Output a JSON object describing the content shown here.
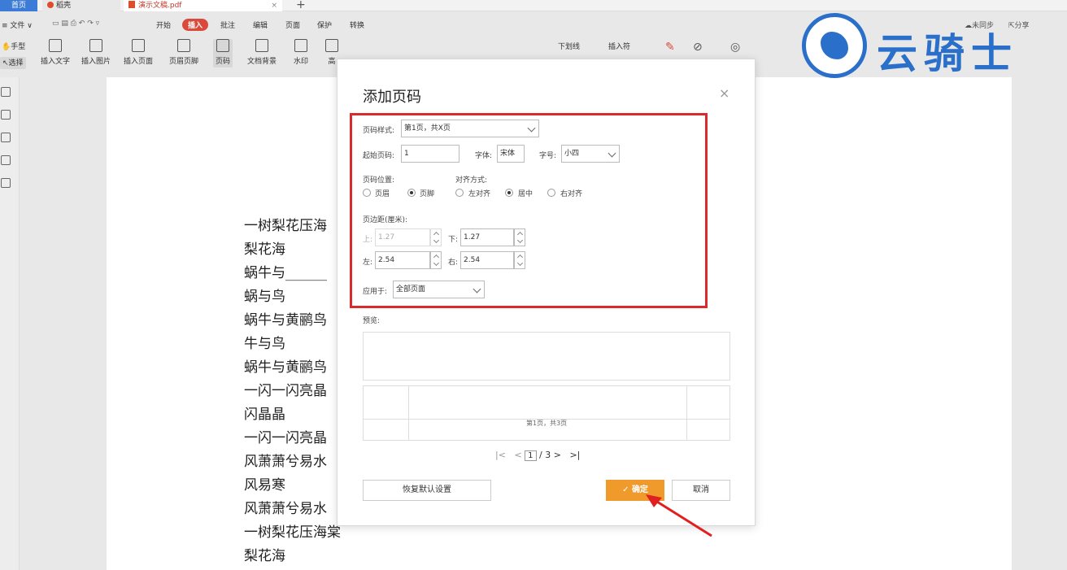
{
  "tabs": {
    "home": "首页",
    "wps": "稻壳",
    "file": "演示文稿.pdf",
    "close": "×",
    "new": "+"
  },
  "menu": {
    "file": "≡ 文件 ∨",
    "items": [
      "开始",
      "插入",
      "批注",
      "编辑",
      "页面",
      "保护",
      "转换"
    ],
    "sync": "未同步",
    "share": "分享"
  },
  "toolbar": {
    "hand": "手型",
    "select": "选择",
    "items": [
      "插入文字",
      "插入图片",
      "插入页面",
      "页眉页脚",
      "页码",
      "文档背景",
      "水印",
      "高"
    ],
    "right_items": [
      "下划线",
      "插入符"
    ]
  },
  "document": {
    "lines": [
      "一树梨花压海",
      "梨花海",
      "蜗牛与______",
      "蜗与鸟",
      "蜗牛与黄鹂鸟",
      "牛与鸟",
      "蜗牛与黄鹂鸟",
      "一闪一闪亮晶",
      "闪晶晶",
      "一闪一闪亮晶",
      "风萧萧兮易水",
      "风易寒",
      "风萧萧兮易水",
      "一树梨花压海棠",
      "梨花海"
    ]
  },
  "logo": {
    "text": "云骑士"
  },
  "dialog": {
    "title": "添加页码",
    "close": "×",
    "style_label": "页码样式:",
    "style_value": "第1页，共X页",
    "start_label": "起始页码:",
    "start_value": "1",
    "font_label": "字体:",
    "font_value": "宋体",
    "size_label": "字号:",
    "size_value": "小四",
    "position_label": "页码位置:",
    "position_options": [
      "页眉",
      "页脚"
    ],
    "position_selected": "页脚",
    "align_label": "对齐方式:",
    "align_options": [
      "左对齐",
      "居中",
      "右对齐"
    ],
    "align_selected": "居中",
    "margin_label": "页边距(厘米):",
    "margin_top_label": "上:",
    "margin_top_value": "1.27",
    "margin_bottom_label": "下:",
    "margin_bottom_value": "1.27",
    "margin_left_label": "左:",
    "margin_left_value": "2.54",
    "margin_right_label": "右:",
    "margin_right_value": "2.54",
    "apply_label": "应用于:",
    "apply_value": "全部页面",
    "preview_label": "预览:",
    "preview_text": "第1页，共3页",
    "pager_current": "1",
    "pager_total": "/ 3",
    "reset_button": "恢复默认设置",
    "ok_button": "确定",
    "cancel_button": "取消"
  },
  "colors": {
    "accent": "#3c7bd6",
    "highlight": "#d92b2b",
    "primary_button": "#f09a2c",
    "logo": "#2a6fc9"
  }
}
